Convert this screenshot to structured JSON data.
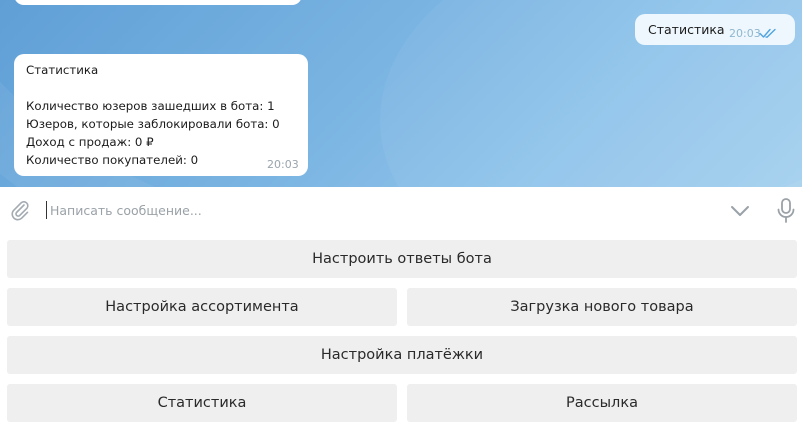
{
  "chat": {
    "outgoing": {
      "text": "Статистика",
      "time": "20:03"
    },
    "incoming": {
      "lines": [
        "Статистика",
        "",
        "Количество юзеров зашедших в бота: 1",
        "Юзеров, которые заблокировали бота: 0",
        "Доход с продаж: 0 ₽",
        "Количество покупателей: 0"
      ],
      "time": "20:03"
    }
  },
  "composer": {
    "placeholder": "Написать сообщение...",
    "value": "",
    "icons": [
      "paperclip-icon",
      "chevron-down-icon",
      "microphone-icon"
    ]
  },
  "keyboard": {
    "buttons": [
      "Настроить ответы бота",
      "Настройка ассортимента",
      "Загрузка нового товара",
      "Настройка платёжки",
      "Статистика",
      "Рассылка"
    ]
  },
  "colors": {
    "outgoing_bubble": "#eef7fd",
    "incoming_bubble": "#ffffff",
    "read_ticks": "#4fa3e0",
    "keyboard_button": "#efefef"
  }
}
